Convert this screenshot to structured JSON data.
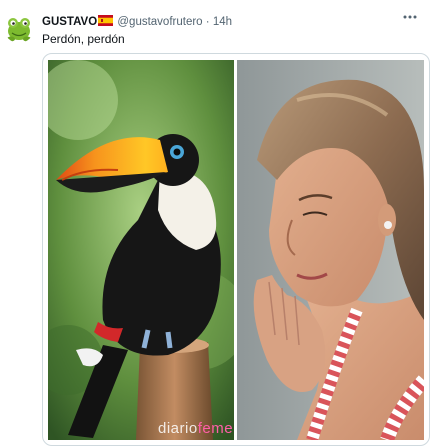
{
  "tweet": {
    "author_name": "GUSTAVO",
    "handle": "@gustavofrutero",
    "separator": "·",
    "time": "14h",
    "text": "Perdón, perdón",
    "more_icon": "more-horizontal-icon"
  },
  "media": {
    "watermark_prefix": "diario",
    "watermark_suffix": "feme",
    "watermark_accent_color": "#ff5fa8"
  },
  "colors": {
    "text_primary": "#0f1419",
    "text_secondary": "#536471",
    "border": "#cfd9de"
  }
}
